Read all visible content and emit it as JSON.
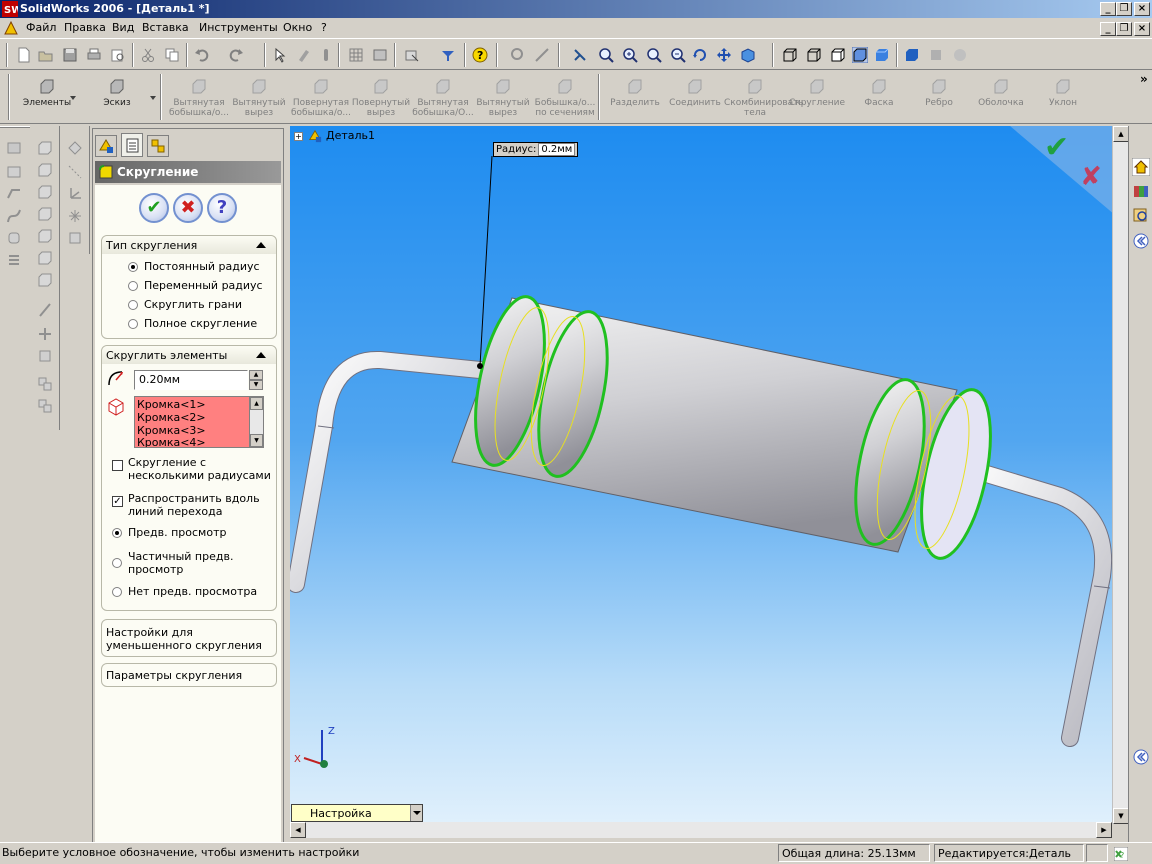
{
  "window": {
    "title": "SolidWorks 2006 - [Деталь1 *]",
    "colors": {
      "titlebar_start": "#0a246a",
      "titlebar_end": "#a6caf0"
    }
  },
  "menu": {
    "items": [
      "Файл",
      "Правка",
      "Вид",
      "Вставка",
      "Инструменты",
      "Окно",
      "?"
    ]
  },
  "toolbar_main": {
    "icons": [
      "new-icon",
      "open-icon",
      "save-icon",
      "print-icon",
      "print-preview-icon",
      "cut-icon",
      "copy-icon",
      "undo-icon",
      "redo-icon",
      "select-icon",
      "rebuild-icon",
      "options-icon",
      "grid-icon",
      "sketch-icon",
      "hide-icon",
      "help-icon",
      "zoom-fit-icon",
      "zoom-area-icon",
      "zoom-in-icon",
      "zoom-out-icon",
      "rotate-icon",
      "pan-icon",
      "view-orientation-icon",
      "wireframe-icon",
      "hidden-lines-icon",
      "shaded-icon",
      "shaded-edges-icon",
      "section-icon",
      "appearance-icon"
    ]
  },
  "features_toolbar": {
    "items": [
      {
        "label": "Элементы",
        "active": true
      },
      {
        "label": "Эскиз",
        "active": true
      },
      {
        "label": "Вытянутая бобышка/о...",
        "active": false
      },
      {
        "label": "Вытянутый вырез",
        "active": false
      },
      {
        "label": "Повернутая бобышка/о...",
        "active": false
      },
      {
        "label": "Повернутый вырез",
        "active": false
      },
      {
        "label": "Вытянутая бобышка/О...",
        "active": false
      },
      {
        "label": "Вытянутый вырез",
        "active": false
      },
      {
        "label": "Бобышка/о... по сечениям",
        "active": false
      },
      {
        "label": "Разделить",
        "active": false
      },
      {
        "label": "Соединить",
        "active": false
      },
      {
        "label": "Скомбинировать тела",
        "active": false
      },
      {
        "label": "Скругление",
        "active": false
      },
      {
        "label": "Фаска",
        "active": false
      },
      {
        "label": "Ребро",
        "active": false
      },
      {
        "label": "Оболочка",
        "active": false
      },
      {
        "label": "Уклон",
        "active": false
      }
    ]
  },
  "property_manager": {
    "title": "Скругление",
    "fillet_type": {
      "title": "Тип скругления",
      "options": [
        {
          "label": "Постоянный радиус",
          "selected": true
        },
        {
          "label": "Переменный радиус",
          "selected": false
        },
        {
          "label": "Скруглить грани",
          "selected": false
        },
        {
          "label": "Полное скругление",
          "selected": false
        }
      ]
    },
    "fillet_items": {
      "title": "Скруглить элементы",
      "radius": "0.20мм",
      "edges": [
        "Кромка<1>",
        "Кромка<2>",
        "Кромка<3>",
        "Кромка<4>"
      ],
      "multi_radius_line1": "Скругление с",
      "multi_radius_line2": "несколькими радиусами",
      "propagate_line1": "Распространить вдоль",
      "propagate_line2": "линий перехода",
      "preview_full": "Предв. просмотр",
      "preview_partial_line1": "Частичный предв.",
      "preview_partial_line2": "просмотр",
      "preview_none": "Нет предв. просмотра",
      "multi_radius_checked": false,
      "propagate_checked": true,
      "preview_selected": "full"
    },
    "setback_line1": "Настройки для",
    "setback_line2": "уменьшенного скругления",
    "options_title": "Параметры скругления"
  },
  "viewport": {
    "tree_node": "Деталь1",
    "callout_label": "Радиус:",
    "callout_value": "0.2мм",
    "configuration": "Настройка",
    "axes": {
      "z": "Z",
      "x": "X"
    }
  },
  "status": {
    "hint": "Выберите условное обозначение, чтобы изменить настройки",
    "total_length": "Общая длина: 25.13мм",
    "editing": "Редактируется:Деталь"
  }
}
